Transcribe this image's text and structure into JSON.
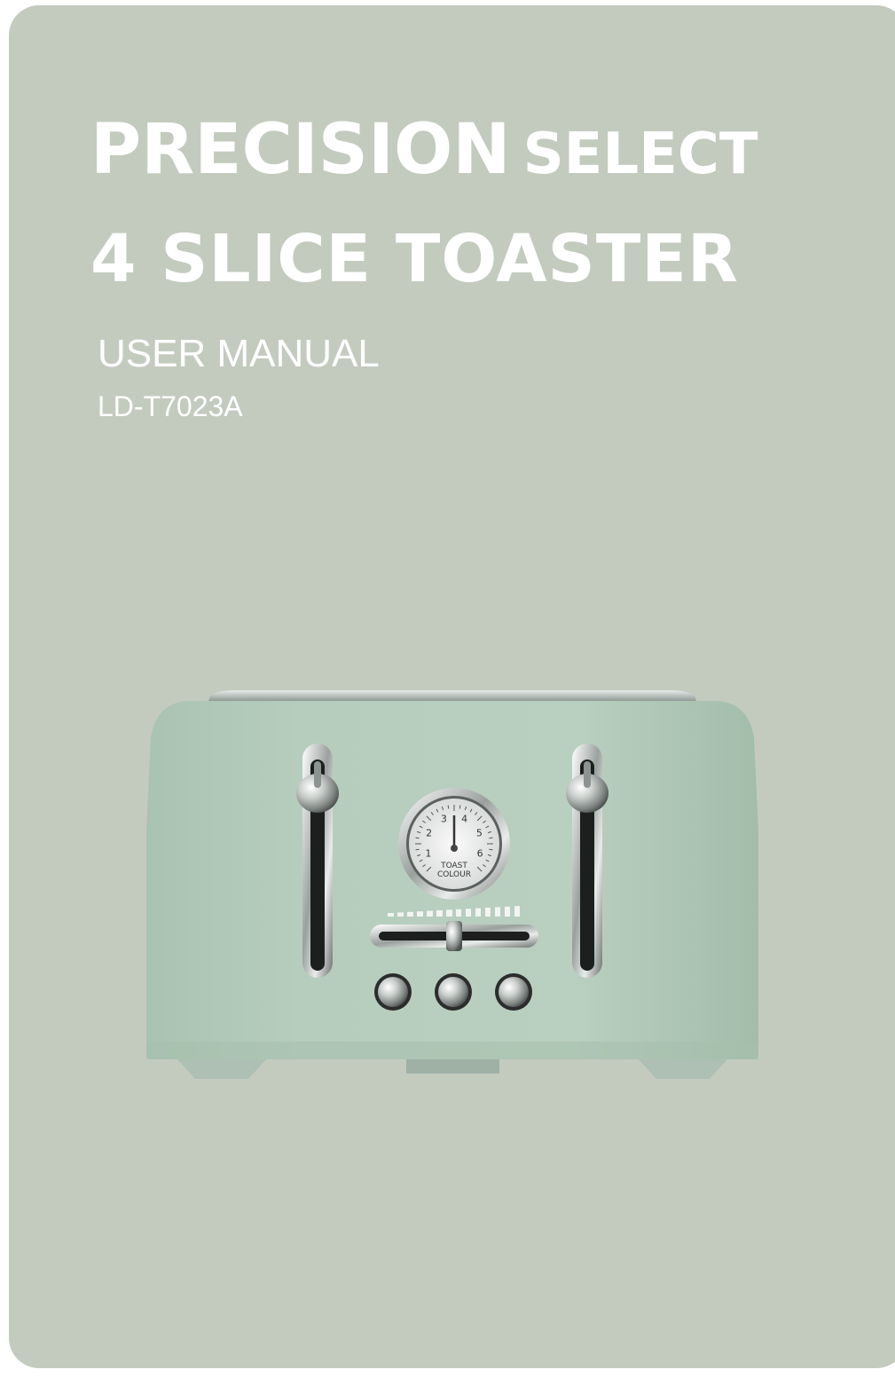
{
  "cover": {
    "title_part1": "PRECISION",
    "title_part2": "SELECT",
    "title_line2": "4 SLICE TOASTER",
    "subtitle": "USER MANUAL",
    "model": "LD-T7023A"
  },
  "dial": {
    "numbers": [
      "1",
      "2",
      "3",
      "4",
      "5",
      "6"
    ],
    "label_line1": "TOAST",
    "label_line2": "COLOUR"
  },
  "colors": {
    "background": "#c3cbbf",
    "toaster_body": "#b4cbbb",
    "text": "#ffffff"
  }
}
